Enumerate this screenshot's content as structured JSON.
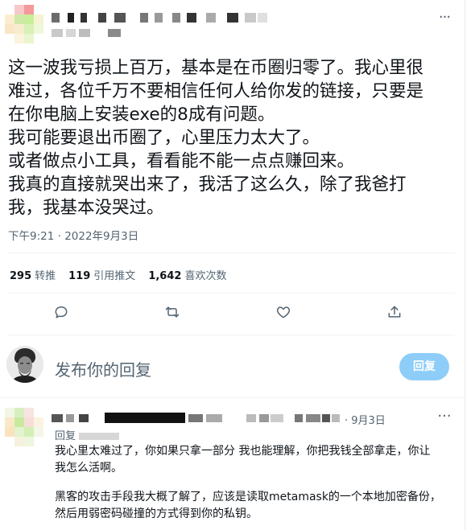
{
  "tweet": {
    "text_lines": [
      "这一波我亏损上百万，基本是在币圈归零了。我心里很",
      "难过，各位千万不要相信任何人给你发的链接，只要是",
      "在你电脑上安装exe的8成有问题。",
      "我可能要退出币圈了，心里压力太大了。",
      "或者做点小工具，看看能不能一点点赚回来。",
      "我真的直接就哭出来了，我活了这么久，除了我爸打",
      "我，我基本没哭过。"
    ],
    "timestamp": "下午9:21 · 2022年9月3日",
    "stats": {
      "retweets": {
        "count": "295",
        "label": "转推"
      },
      "quotes": {
        "count": "119",
        "label": "引用推文"
      },
      "likes": {
        "count": "1,642",
        "label": "喜欢次数"
      }
    }
  },
  "compose": {
    "placeholder": "发布你的回复",
    "button_label": "回复"
  },
  "reply": {
    "time": "9月3日",
    "replying_label": "回复",
    "text_paragraphs": [
      "我心里太难过了，你如果只拿一部分 我也能理解，你把我钱全部拿走，你让",
      "我怎么活啊。",
      "黑客的攻击手段我大概了解了，应该是读取metamask的一个本地加密备份，",
      "然后用弱密码碰撞的方式得到你的私钥。"
    ]
  },
  "icons": {
    "more": "more-horizontal-icon",
    "reply": "comment-icon",
    "retweet": "retweet-icon",
    "like": "heart-icon",
    "share": "share-icon"
  },
  "colors": {
    "accent": "#1d9bf0",
    "reply_button": "#8ecdf8",
    "secondary_text": "#536471"
  }
}
